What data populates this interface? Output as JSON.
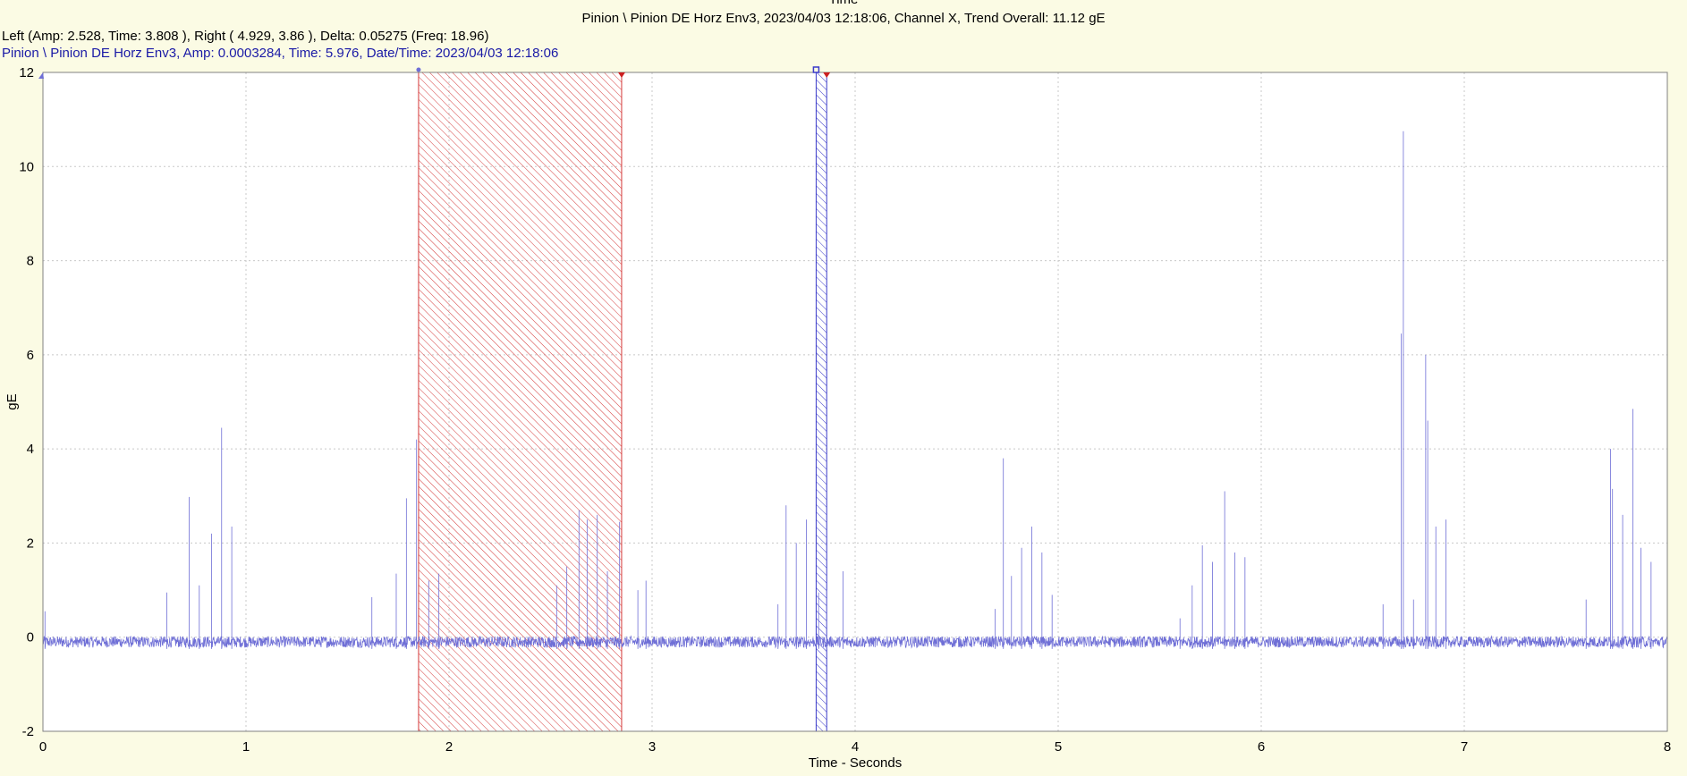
{
  "header": {
    "title": "Time",
    "subtitle": "Pinion \\ Pinion DE Horz Env3, 2023/04/03 12:18:06, Channel X, Trend Overall: 11.12 gE",
    "cursor_readout": "Left (Amp: 2.528, Time: 3.808 ), Right (  4.929,  3.86 ), Delta: 0.05275 (Freq: 18.96)",
    "trace_readout": "Pinion \\ Pinion DE Horz Env3, Amp: 0.0003284,  Time: 5.976, Date/Time: 2023/04/03 12:18:06"
  },
  "colors": {
    "background": "#fbfbe4",
    "plot_background": "#ffffff",
    "trace": "#6f6fd6",
    "red_band": "#d43a3a",
    "blue_band": "#3b3bc9",
    "grid": "#c8c8c8",
    "readout_blue": "#1a1aa6"
  },
  "chart_data": {
    "type": "line",
    "title": "Time",
    "xlabel": "Time - Seconds",
    "ylabel": "gE",
    "xlim": [
      0,
      8
    ],
    "ylim": [
      -2,
      12
    ],
    "xticks": [
      "0",
      "1",
      "2",
      "3",
      "4",
      "5",
      "6",
      "7",
      "8"
    ],
    "yticks": [
      "-2",
      "0",
      "2",
      "4",
      "6",
      "8",
      "10",
      "12"
    ],
    "grid": true,
    "baseline": -0.1,
    "noise_amplitude": 0.12,
    "peaks": [
      [
        0.01,
        0.55
      ],
      [
        0.61,
        0.95
      ],
      [
        0.72,
        2.98
      ],
      [
        0.77,
        1.1
      ],
      [
        0.83,
        2.2
      ],
      [
        0.88,
        4.45
      ],
      [
        0.93,
        2.35
      ],
      [
        1.62,
        0.85
      ],
      [
        1.74,
        1.35
      ],
      [
        1.79,
        2.95
      ],
      [
        1.84,
        4.2
      ],
      [
        1.9,
        1.2
      ],
      [
        1.95,
        1.35
      ],
      [
        2.53,
        1.1
      ],
      [
        2.58,
        1.5
      ],
      [
        2.64,
        2.7
      ],
      [
        2.68,
        2.5
      ],
      [
        2.73,
        2.6
      ],
      [
        2.78,
        1.4
      ],
      [
        2.84,
        2.45
      ],
      [
        2.93,
        1.0
      ],
      [
        2.97,
        1.2
      ],
      [
        3.62,
        0.7
      ],
      [
        3.66,
        2.8
      ],
      [
        3.71,
        2.0
      ],
      [
        3.76,
        2.5
      ],
      [
        3.82,
        0.95
      ],
      [
        3.86,
        1.0
      ],
      [
        3.94,
        1.4
      ],
      [
        4.69,
        0.6
      ],
      [
        4.73,
        3.8
      ],
      [
        4.77,
        1.3
      ],
      [
        4.82,
        1.9
      ],
      [
        4.87,
        2.35
      ],
      [
        4.92,
        1.8
      ],
      [
        4.97,
        0.9
      ],
      [
        5.6,
        0.4
      ],
      [
        5.66,
        1.1
      ],
      [
        5.71,
        1.95
      ],
      [
        5.76,
        1.6
      ],
      [
        5.82,
        3.1
      ],
      [
        5.87,
        1.8
      ],
      [
        5.92,
        1.7
      ],
      [
        6.6,
        0.7
      ],
      [
        6.69,
        6.45
      ],
      [
        6.7,
        10.75
      ],
      [
        6.75,
        0.8
      ],
      [
        6.81,
        6.0
      ],
      [
        6.82,
        4.6
      ],
      [
        6.86,
        2.35
      ],
      [
        6.91,
        2.5
      ],
      [
        7.6,
        0.8
      ],
      [
        7.72,
        4.0
      ],
      [
        7.73,
        3.15
      ],
      [
        7.78,
        2.6
      ],
      [
        7.83,
        4.85
      ],
      [
        7.87,
        1.9
      ],
      [
        7.92,
        1.6
      ]
    ],
    "cursor_band_left": {
      "x_start": 1.85,
      "x_end": 2.85,
      "color": "red"
    },
    "cursor_band_right": {
      "x_start": 3.808,
      "x_end": 3.86,
      "color": "blue"
    }
  }
}
